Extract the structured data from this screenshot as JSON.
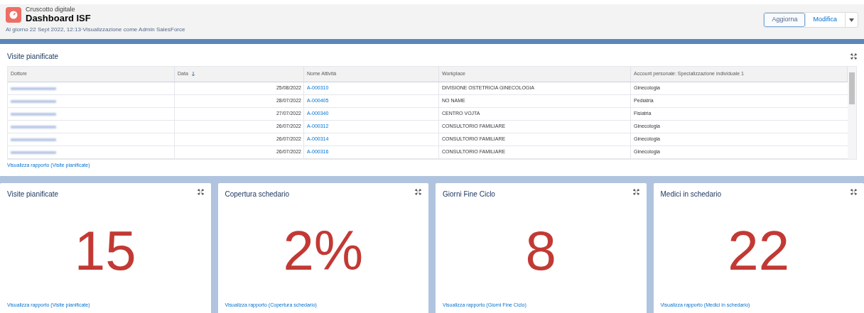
{
  "header": {
    "subtitle": "Cruscotto digitale",
    "title": "Dashboard ISF",
    "info": "Al giorno 22 Sept 2022, 12:13·Visualizzazione come Admin SalesForce",
    "buttons": [
      {
        "label": "Aggiorna",
        "selected": true
      },
      {
        "label": "Modifica",
        "selected": false
      }
    ]
  },
  "table_widget": {
    "title": "Visite pianificate",
    "columns": [
      {
        "label": "Dottore",
        "sorted": false
      },
      {
        "label": "Data",
        "sorted": true
      },
      {
        "label": "Nome Attività",
        "sorted": false
      },
      {
        "label": "Workplace",
        "sorted": false
      },
      {
        "label": "Account personale: Specializzazione individuale 1",
        "sorted": false
      }
    ],
    "rows": [
      {
        "date": "25/08/2022",
        "activity": "A-000310",
        "workplace": "DIVISIONE OSTETRICIA GINECOLOGIA",
        "specialty": "Ginecologia"
      },
      {
        "date": "28/07/2022",
        "activity": "A-000405",
        "workplace": "NO NAME",
        "specialty": "Pediatria"
      },
      {
        "date": "27/07/2022",
        "activity": "A-000340",
        "workplace": "CENTRO VOJTA",
        "specialty": "Fisiatria"
      },
      {
        "date": "26/07/2022",
        "activity": "A-000312",
        "workplace": "CONSULTORIO FAMILIARE",
        "specialty": "Ginecologia"
      },
      {
        "date": "26/07/2022",
        "activity": "A-000314",
        "workplace": "CONSULTORIO FAMILIARE",
        "specialty": "Ginecologia"
      },
      {
        "date": "26/07/2022",
        "activity": "A-000316",
        "workplace": "CONSULTORIO FAMILIARE",
        "specialty": "Ginecologia"
      }
    ],
    "link": "Visualizza rapporto (Visite pianificate)"
  },
  "metrics": [
    {
      "title": "Visite pianificate",
      "value": "15",
      "link": "Visualizza rapporto (Visite pianificate)"
    },
    {
      "title": "Copertura schedario",
      "value": "2%",
      "link": "Visualizza rapporto (Copertura schedario)"
    },
    {
      "title": "Giorni Fine Ciclo",
      "value": "8",
      "link": "Visualizza rapporto (Giorni Fine Ciclo)"
    },
    {
      "title": "Medici in schedario",
      "value": "22",
      "link": "Visualizza rapporto (Medici in schedario)"
    }
  ]
}
